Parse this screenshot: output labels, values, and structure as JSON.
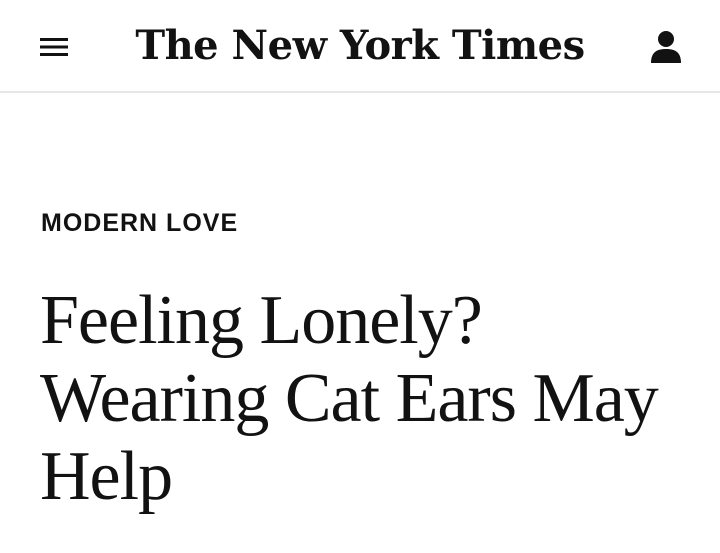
{
  "header": {
    "menu_icon": "hamburger-menu-icon",
    "logo_text": "The New York Times",
    "account_icon": "user-account-icon"
  },
  "article": {
    "kicker": "MODERN LOVE",
    "headline": "Feeling Lonely? Wearing Cat Ears May Help"
  },
  "colors": {
    "text": "#121212",
    "divider": "#e6e6e6",
    "background": "#ffffff"
  }
}
